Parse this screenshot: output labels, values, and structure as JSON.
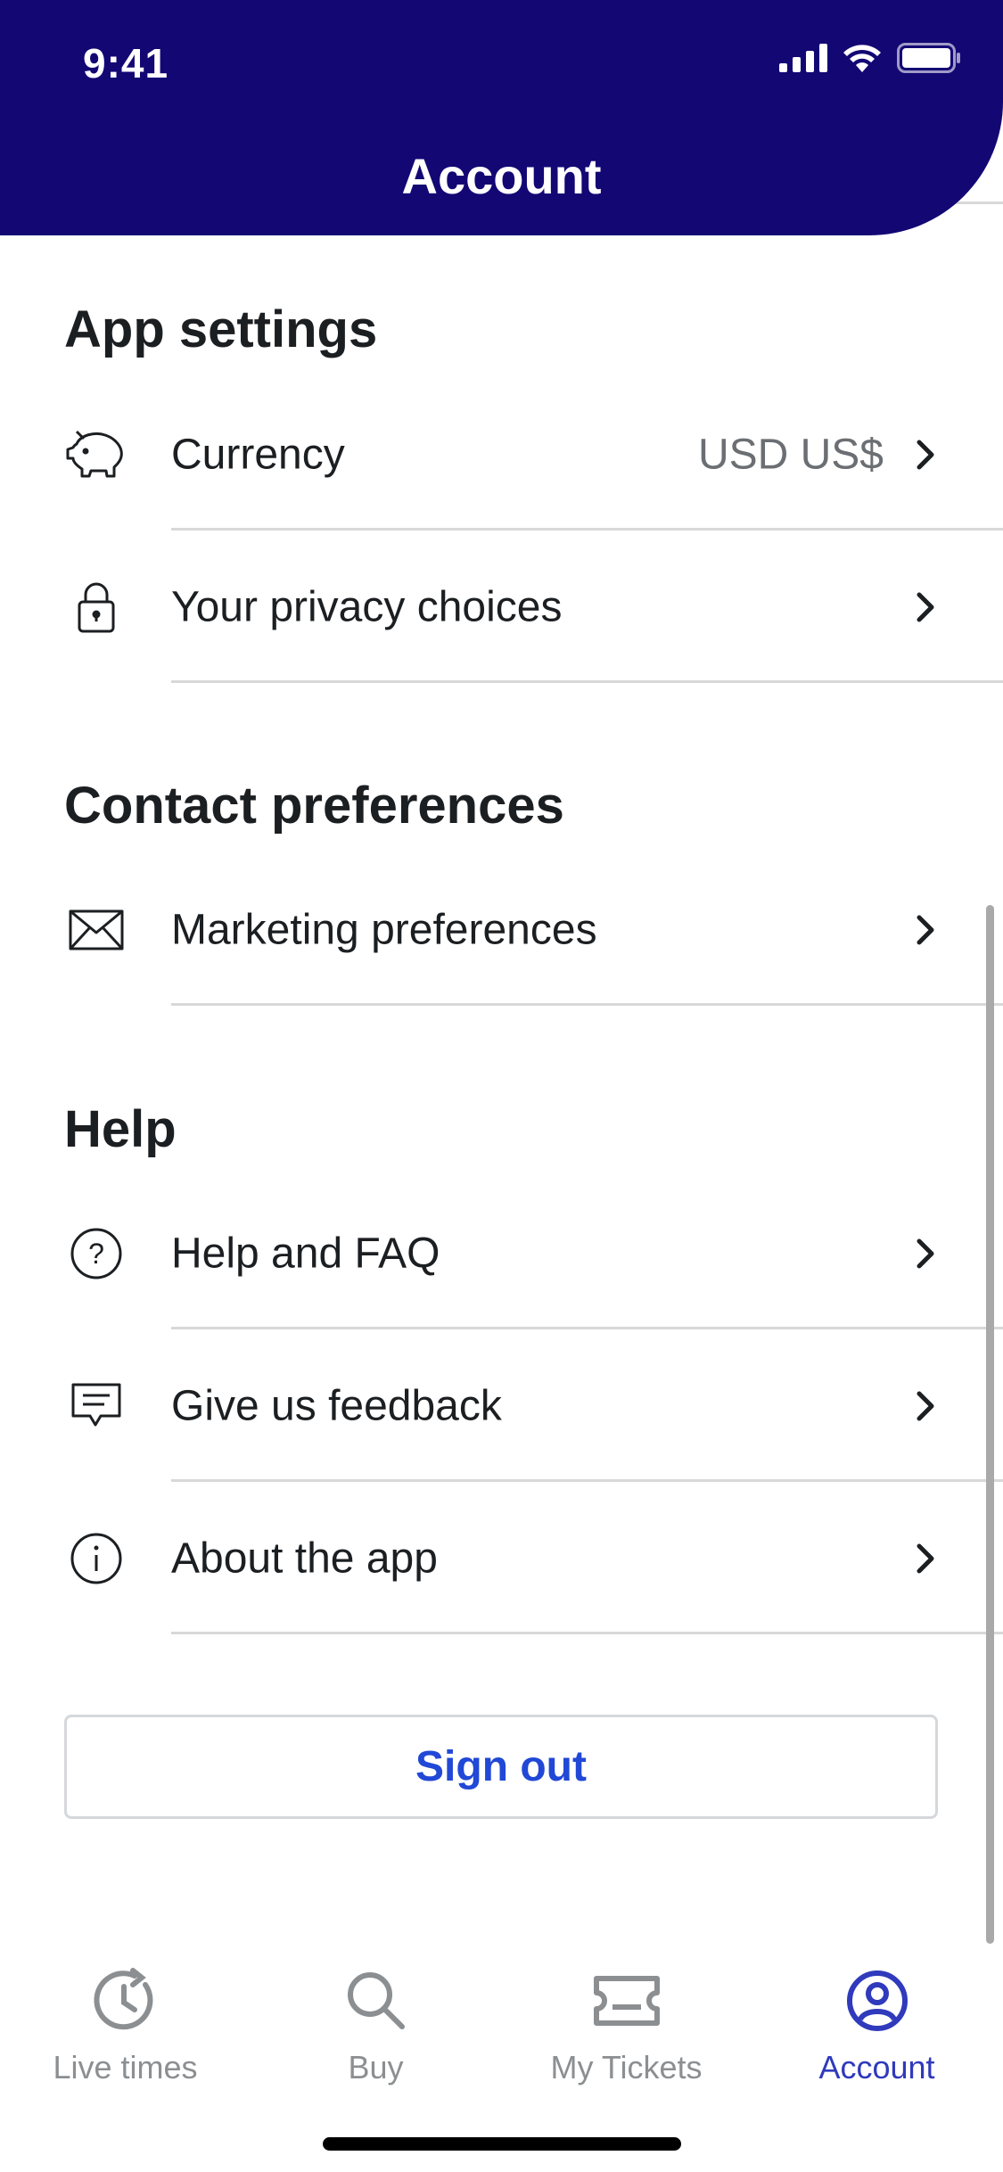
{
  "status_bar": {
    "time": "9:41"
  },
  "header": {
    "title": "Account"
  },
  "sections": [
    {
      "heading": "App settings",
      "items": [
        {
          "label": "Currency",
          "value": "USD US$",
          "icon": "piggy-bank-icon"
        },
        {
          "label": "Your privacy choices",
          "value": "",
          "icon": "lock-icon"
        }
      ]
    },
    {
      "heading": "Contact preferences",
      "items": [
        {
          "label": "Marketing preferences",
          "value": "",
          "icon": "envelope-icon"
        }
      ]
    },
    {
      "heading": "Help",
      "items": [
        {
          "label": "Help and FAQ",
          "value": "",
          "icon": "question-circle-icon"
        },
        {
          "label": "Give us feedback",
          "value": "",
          "icon": "chat-bubble-icon"
        },
        {
          "label": "About the app",
          "value": "",
          "icon": "info-circle-icon"
        }
      ]
    }
  ],
  "sign_out_label": "Sign out",
  "tabs": [
    {
      "label": "Live times",
      "icon": "clock-icon",
      "active": false
    },
    {
      "label": "Buy",
      "icon": "search-icon",
      "active": false
    },
    {
      "label": "My Tickets",
      "icon": "ticket-icon",
      "active": false
    },
    {
      "label": "Account",
      "icon": "account-icon",
      "active": true
    }
  ],
  "colors": {
    "header_background": "#130774",
    "link_blue": "#2148d6",
    "active_tab": "#2f3abc",
    "inactive_tab": "#8c8f92",
    "divider": "#d8d8d8"
  }
}
